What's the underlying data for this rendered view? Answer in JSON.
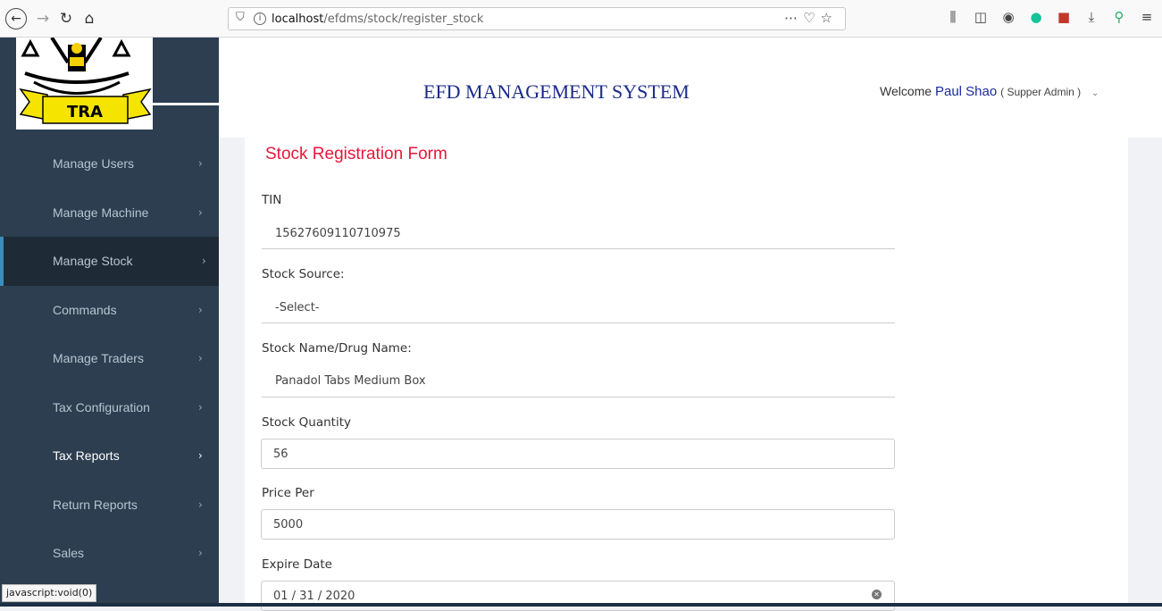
{
  "browser": {
    "url_host": "localhost",
    "url_path": "/efdms/stock/register_stock",
    "icons": [
      "back-icon",
      "forward-icon",
      "reload-icon",
      "home-icon",
      "shield-icon",
      "info-icon",
      "more-icon",
      "pocket-icon",
      "bookmark-star-icon",
      "library-icon",
      "sidebar-icon",
      "extension-icon",
      "grammarly-icon",
      "extension-red-icon",
      "download-icon",
      "search-extension-icon",
      "menu-icon"
    ]
  },
  "header": {
    "logo_text": "TRA",
    "title": "EFD MANAGEMENT SYSTEM",
    "welcome_prefix": "Welcome",
    "user_name": "Paul Shao",
    "user_role": "( Supper Admin )"
  },
  "sidebar": {
    "items": [
      {
        "label": "Manage Users"
      },
      {
        "label": "Manage Machine"
      },
      {
        "label": "Manage Stock"
      },
      {
        "label": "Commands"
      },
      {
        "label": "Manage Traders"
      },
      {
        "label": "Tax Configuration"
      },
      {
        "label": "Tax Reports"
      },
      {
        "label": "Return Reports"
      },
      {
        "label": "Sales"
      }
    ]
  },
  "form": {
    "title": "Stock Registration Form",
    "tin_label": "TIN",
    "tin_value": "15627609110710975",
    "source_label": "Stock Source:",
    "source_value": "-Select-",
    "name_label": "Stock Name/Drug Name:",
    "name_value": "Panadol Tabs Medium Box",
    "quantity_label": "Stock Quantity",
    "quantity_value": "56",
    "price_label": "Price Per",
    "price_value": "5000",
    "expire_label": "Expire Date",
    "expire_value": "01 / 31 / 2020"
  },
  "status": {
    "link_tip": "javascript:void(0)"
  },
  "colors": {
    "sidebar_bg": "#2c3e50",
    "active_item_bg": "#1e2a36",
    "form_title": "#e8173a",
    "system_title": "#1a2a8a"
  }
}
